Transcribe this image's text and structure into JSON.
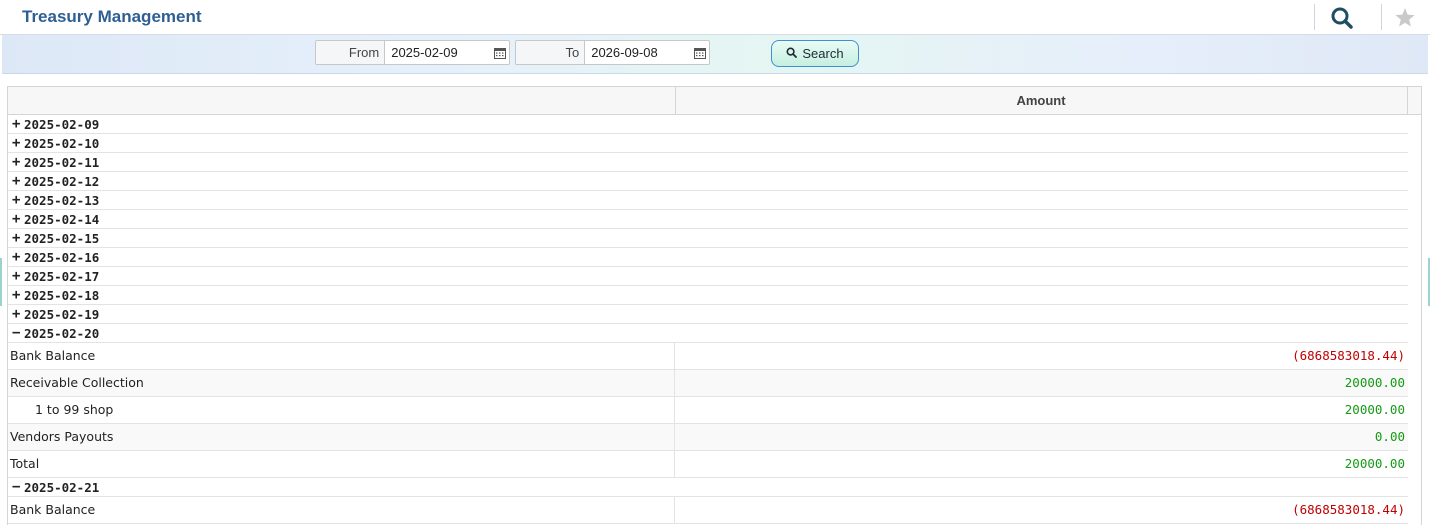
{
  "header": {
    "title": "Treasury Management"
  },
  "toolbar": {
    "from_label": "From",
    "from_value": "2025-02-09",
    "to_label": "To",
    "to_value": "2026-09-08",
    "search_label": "Search"
  },
  "grid": {
    "columns": [
      "",
      "Amount"
    ],
    "collapsed_dates": [
      "2025-02-09",
      "2025-02-10",
      "2025-02-11",
      "2025-02-12",
      "2025-02-13",
      "2025-02-14",
      "2025-02-15",
      "2025-02-16",
      "2025-02-17",
      "2025-02-18",
      "2025-02-19"
    ],
    "expanded_1": {
      "date": "2025-02-20",
      "rows": [
        {
          "label": "Bank Balance",
          "amount": "(6868583018.44)"
        },
        {
          "label": "Receivable Collection",
          "amount": "20000.00"
        },
        {
          "label": "1 to 99 shop",
          "amount": "20000.00"
        },
        {
          "label": "Vendors Payouts",
          "amount": "0.00"
        },
        {
          "label": "Total",
          "amount": "20000.00"
        }
      ]
    },
    "expanded_2": {
      "date": "2025-02-21",
      "rows": [
        {
          "label": "Bank Balance",
          "amount": "(6868583018.44)"
        }
      ]
    }
  },
  "icons": {
    "search": "search-icon",
    "favorite": "star-icon",
    "calendar": "calendar-icon",
    "expand": "plus-icon",
    "collapse": "minus-icon"
  },
  "colors": {
    "title": "#2e5f94",
    "negative": "#c00000",
    "positive": "#159b15",
    "button_border": "#3d8fd6"
  }
}
